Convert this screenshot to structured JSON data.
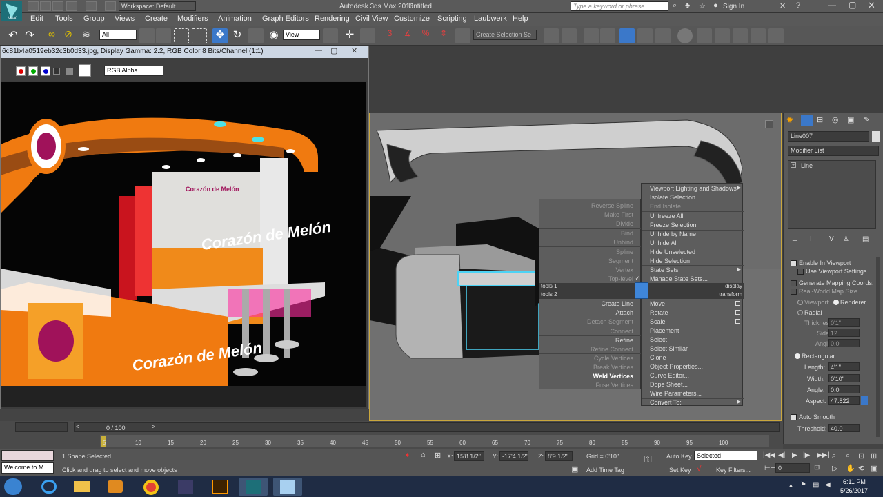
{
  "window": {
    "workspace_label": "Workspace: Default",
    "app_title": "Autodesk 3ds Max 2016",
    "doc_title": "Untitled",
    "search_placeholder": "Type a keyword or phrase",
    "sign_in": "Sign In"
  },
  "menu": [
    "Edit",
    "Tools",
    "Group",
    "Views",
    "Create",
    "Modifiers",
    "Animation",
    "Graph Editors",
    "Rendering",
    "Civil View",
    "Customize",
    "Scripting",
    "Laubwerk",
    "Help"
  ],
  "toolbar": {
    "filter_value": "All",
    "ref_coord_value": "View",
    "selection_set_placeholder": "Create Selection Se"
  },
  "frame_window": {
    "title": "6c81b4a0519eb32c3b0d33.jpg, Display Gamma: 2.2, RGB Color 8 Bits/Channel (1:1)",
    "channel_value": "RGB Alpha",
    "scene_texts": [
      "Corazón de Melón",
      "Corazón de Melón",
      "Corazón de Melón"
    ]
  },
  "quad_menu": {
    "left": [
      {
        "label": "Reverse Spline",
        "state": "dis"
      },
      {
        "label": "Make First",
        "state": "dis"
      },
      {
        "label": "Divide",
        "state": "dis"
      },
      {
        "label": "Bind",
        "state": "dis"
      },
      {
        "label": "Unbind",
        "state": "dis"
      },
      {
        "label": "Spline",
        "state": "dis"
      },
      {
        "label": "Segment",
        "state": "dis"
      },
      {
        "label": "Vertex",
        "state": "dis"
      },
      {
        "label": "Top-level",
        "state": "dis"
      },
      {
        "label": "Create Line",
        "state": ""
      },
      {
        "label": "Attach",
        "state": ""
      },
      {
        "label": "Detach Segment",
        "state": "dis"
      },
      {
        "label": "Connect",
        "state": "dis"
      },
      {
        "label": "Refine",
        "state": ""
      },
      {
        "label": "Refine Connect",
        "state": "dis"
      },
      {
        "label": "Cycle Vertices",
        "state": "dis"
      },
      {
        "label": "Break Vertices",
        "state": "dis"
      },
      {
        "label": "Weld Vertices",
        "state": "bold"
      },
      {
        "label": "Fuse Vertices",
        "state": "dis"
      }
    ],
    "right": [
      {
        "label": "Viewport Lighting and Shadows",
        "state": ""
      },
      {
        "label": "Isolate Selection",
        "state": ""
      },
      {
        "label": "End Isolate",
        "state": "dis"
      },
      {
        "label": "Unfreeze All",
        "state": ""
      },
      {
        "label": "Freeze Selection",
        "state": ""
      },
      {
        "label": "Unhide by Name",
        "state": ""
      },
      {
        "label": "Unhide All",
        "state": ""
      },
      {
        "label": "Hide Unselected",
        "state": ""
      },
      {
        "label": "Hide Selection",
        "state": ""
      },
      {
        "label": "State Sets",
        "state": ""
      },
      {
        "label": "Manage State Sets...",
        "state": ""
      },
      {
        "label": "Move",
        "state": ""
      },
      {
        "label": "Rotate",
        "state": ""
      },
      {
        "label": "Scale",
        "state": ""
      },
      {
        "label": "Placement",
        "state": ""
      },
      {
        "label": "Select",
        "state": ""
      },
      {
        "label": "Select Similar",
        "state": ""
      },
      {
        "label": "Clone",
        "state": ""
      },
      {
        "label": "Object Properties...",
        "state": ""
      },
      {
        "label": "Curve Editor...",
        "state": ""
      },
      {
        "label": "Dope Sheet...",
        "state": ""
      },
      {
        "label": "Wire Parameters...",
        "state": ""
      },
      {
        "label": "Convert To:",
        "state": ""
      }
    ],
    "bar_tools1": "tools 1",
    "bar_tools2": "tools 2",
    "bar_display": "display",
    "bar_transform": "transform"
  },
  "command_panel": {
    "object_name": "Line007",
    "modifier_list": "Modifier List",
    "stack_item": "Line",
    "enable_in_viewport": "Enable In Viewport",
    "use_viewport_settings": "Use Viewport Settings",
    "generate_mapping": "Generate Mapping Coords.",
    "real_world_map": "Real-World Map Size",
    "viewport": "Viewport",
    "renderer": "Renderer",
    "radial": "Radial",
    "thickness_label": "Thickness:",
    "thickness_value": "0'1\"",
    "sides_label": "Sides:",
    "sides_value": "12",
    "angle_label": "Angle:",
    "angle_value": "0.0",
    "rectangular": "Rectangular",
    "length_label": "Length:",
    "length_value": "4'1\"",
    "width_label": "Width:",
    "width_value": "0'10\"",
    "angle2_label": "Angle:",
    "angle2_value": "0.0",
    "aspect_label": "Aspect:",
    "aspect_value": "47.822",
    "auto_smooth": "Auto Smooth",
    "threshold_label": "Threshold:",
    "threshold_value": "40.0"
  },
  "timeline": {
    "frame_counter": "0 / 100",
    "ticks": [
      "5",
      "10",
      "15",
      "20",
      "25",
      "30",
      "35",
      "40",
      "45",
      "50",
      "55",
      "60",
      "65",
      "70",
      "75",
      "80",
      "85",
      "90",
      "95",
      "100"
    ]
  },
  "status": {
    "welcome": "Welcome to M",
    "selected_count": "1 Shape Selected",
    "prompt": "Click and drag to select and move objects",
    "x_label": "X:",
    "x_value": "15'8 1/2\"",
    "y_label": "Y:",
    "y_value": "-17'4 1/2\"",
    "z_label": "Z:",
    "z_value": "8'9 1/2\"",
    "grid": "Grid = 0'10\"",
    "add_time_tag": "Add Time Tag",
    "auto_key": "Auto Key",
    "auto_key_mode": "Selected",
    "set_key": "Set Key",
    "key_filters": "Key Filters...",
    "current_frame": "0"
  },
  "taskbar": {
    "time": "6:11 PM",
    "date": "5/26/2017"
  }
}
